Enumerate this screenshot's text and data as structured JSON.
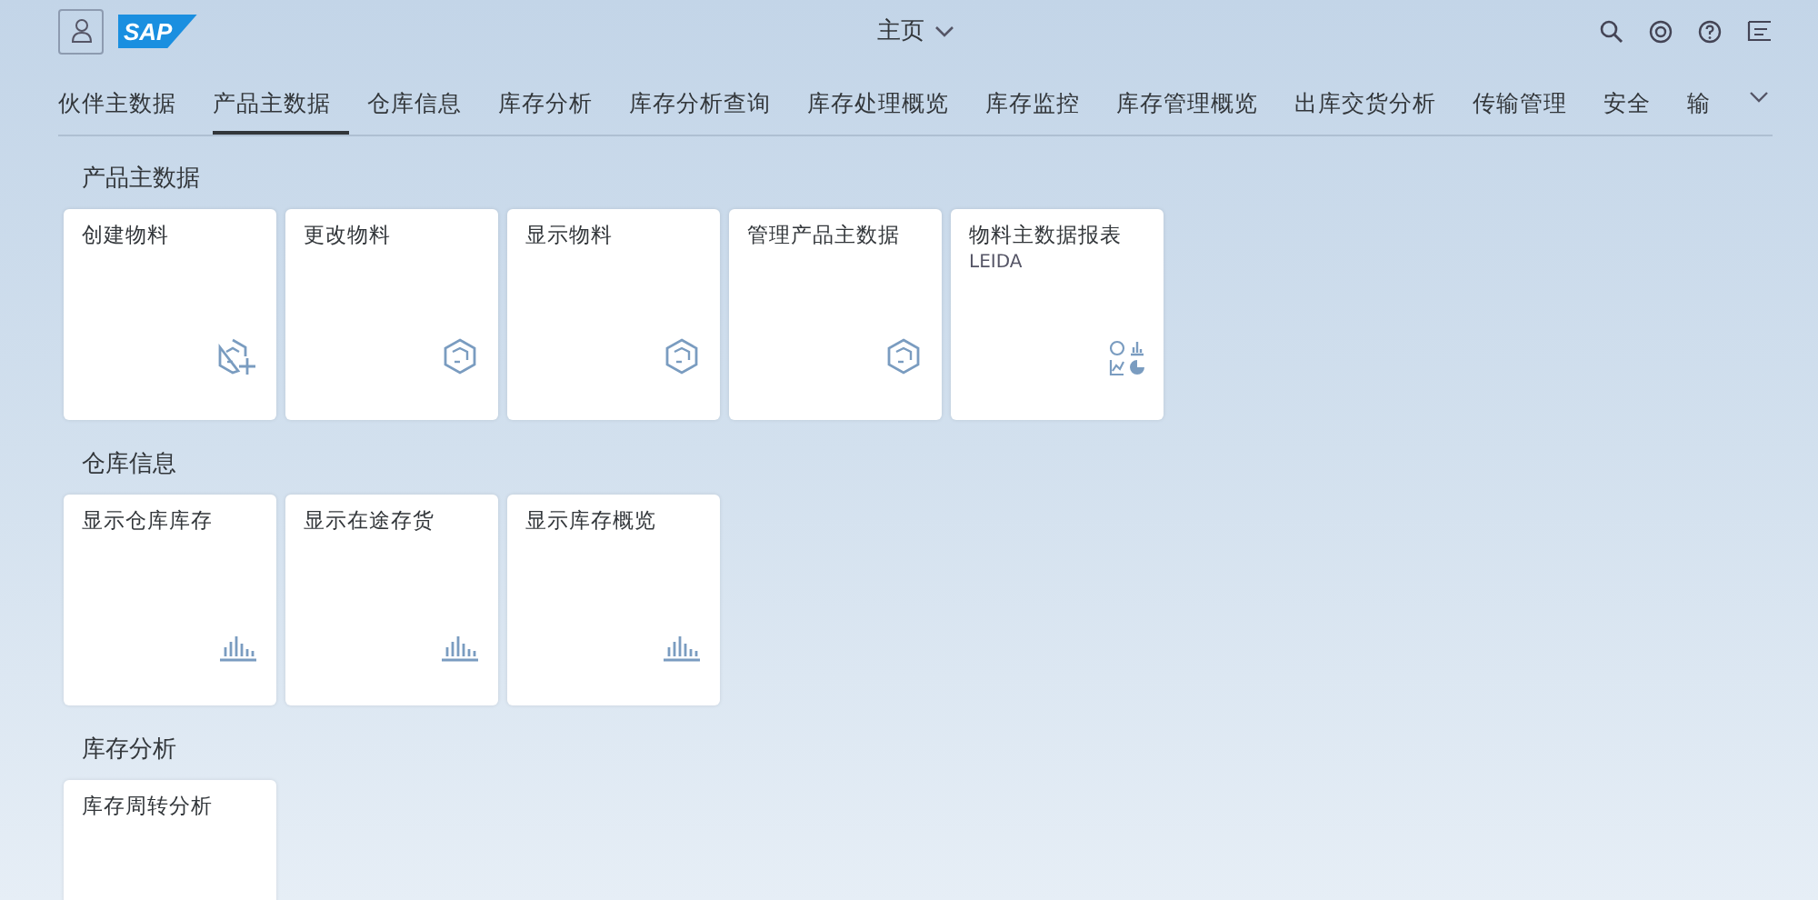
{
  "shell_bar": {
    "logo": "SAP",
    "title": "主页"
  },
  "tabs": [
    {
      "label": "伙伴主数据",
      "selected": false
    },
    {
      "label": "产品主数据",
      "selected": true
    },
    {
      "label": "仓库信息",
      "selected": false
    },
    {
      "label": "库存分析",
      "selected": false
    },
    {
      "label": "库存分析查询",
      "selected": false
    },
    {
      "label": "库存处理概览",
      "selected": false
    },
    {
      "label": "库存监控",
      "selected": false
    },
    {
      "label": "库存管理概览",
      "selected": false
    },
    {
      "label": "出库交货分析",
      "selected": false
    },
    {
      "label": "传输管理",
      "selected": false
    },
    {
      "label": "安全",
      "selected": false
    },
    {
      "label": "输",
      "selected": false
    }
  ],
  "groups": [
    {
      "title": "产品主数据",
      "tiles": [
        {
          "title": "创建物料",
          "kind": "create"
        },
        {
          "title": "更改物料",
          "kind": "object"
        },
        {
          "title": "显示物料",
          "kind": "object"
        },
        {
          "title": "管理产品主数据",
          "kind": "object"
        },
        {
          "title": "物料主数据报表",
          "subtitle": "LEIDA",
          "kind": "report"
        }
      ]
    },
    {
      "title": "仓库信息",
      "tiles": [
        {
          "title": "显示仓库库存",
          "kind": "analytics"
        },
        {
          "title": "显示在途存货",
          "kind": "analytics"
        },
        {
          "title": "显示库存概览",
          "kind": "analytics"
        }
      ]
    },
    {
      "title": "库存分析",
      "tiles": [
        {
          "title": "库存周转分析"
        }
      ]
    }
  ]
}
